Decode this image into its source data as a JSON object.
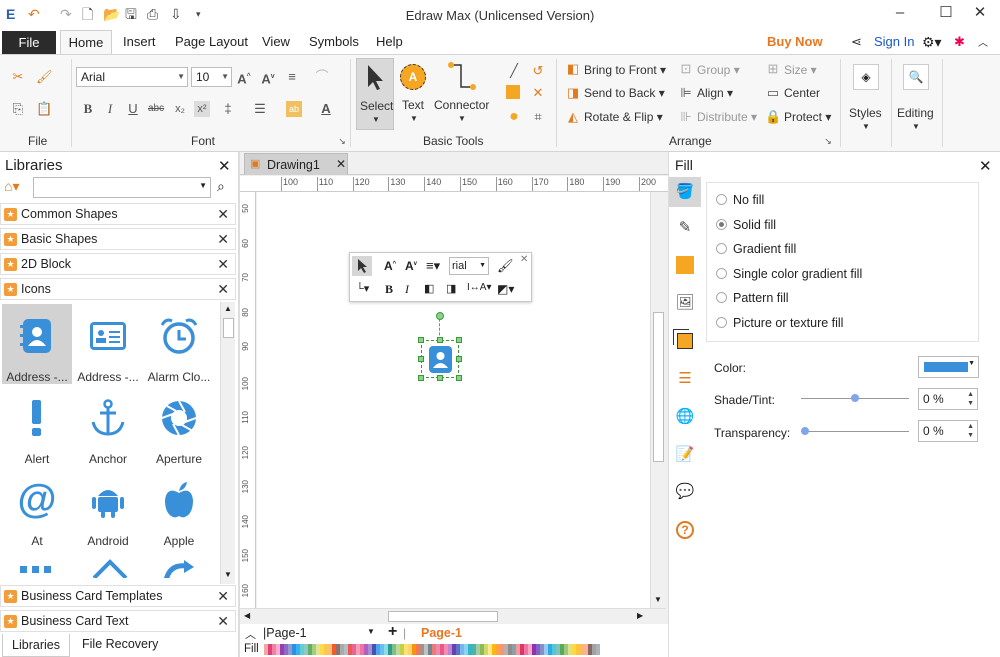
{
  "app": {
    "title": "Edraw Max (Unlicensed Version)"
  },
  "menu": {
    "file": "File",
    "tabs": [
      "Home",
      "Insert",
      "Page Layout",
      "View",
      "Symbols",
      "Help"
    ],
    "buy_now": "Buy Now",
    "sign_in": "Sign In"
  },
  "ribbon": {
    "file_group": "File",
    "font_group": "Font",
    "font_name": "Arial",
    "font_size": "10",
    "basic_tools_group": "Basic Tools",
    "select": "Select",
    "text": "Text",
    "connector": "Connector",
    "arrange_group": "Arrange",
    "bring_to_front": "Bring to Front",
    "send_to_back": "Send to Back",
    "rotate_flip": "Rotate & Flip",
    "group": "Group",
    "align": "Align",
    "distribute": "Distribute",
    "size": "Size",
    "center": "Center",
    "protect": "Protect",
    "styles": "Styles",
    "editing": "Editing"
  },
  "libraries": {
    "title": "Libraries",
    "search_placeholder": "",
    "categories": [
      "Common Shapes",
      "Basic Shapes",
      "2D Block",
      "Icons"
    ],
    "shapes": [
      "Address -...",
      "Address -...",
      "Alarm Clo...",
      "Alert",
      "Anchor",
      "Aperture",
      "At",
      "Android",
      "Apple"
    ],
    "bottom_categories": [
      "Business Card Templates",
      "Business Card Text"
    ],
    "bottom_tabs": [
      "Libraries",
      "File Recovery"
    ]
  },
  "document": {
    "tab": "Drawing1",
    "hruler": [
      "100",
      "110",
      "120",
      "130",
      "140",
      "150",
      "160",
      "170",
      "180",
      "190",
      "200"
    ],
    "vruler": [
      "50",
      "60",
      "70",
      "80",
      "90",
      "100",
      "110",
      "120",
      "130",
      "140",
      "150",
      "160",
      "60"
    ],
    "page_select": "Page-1",
    "active_page": "Page-1",
    "fill_label": "Fill",
    "mini_font": "rial"
  },
  "fill_panel": {
    "title": "Fill",
    "options": [
      "No fill",
      "Solid fill",
      "Gradient fill",
      "Single color gradient fill",
      "Pattern fill",
      "Picture or texture fill"
    ],
    "selected_option": "Solid fill",
    "color_label": "Color:",
    "color_value": "#3a8fd9",
    "shade_label": "Shade/Tint:",
    "shade_value": "0 %",
    "transparency_label": "Transparency:",
    "transparency_value": "0 %"
  },
  "colors": {
    "accent": "#3a8fd9",
    "file_tab": "#2b2b2b",
    "buy_now": "#e87722",
    "page_tab": "#e87722"
  }
}
